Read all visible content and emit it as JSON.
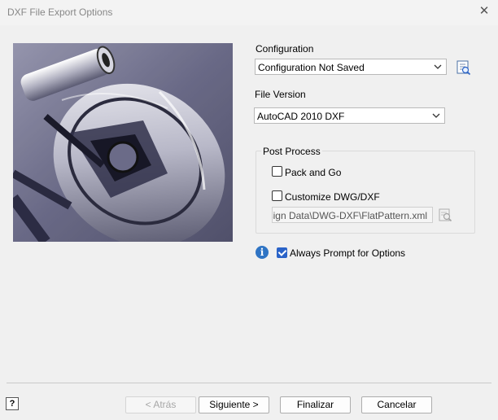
{
  "window": {
    "title": "DXF File Export Options",
    "close_icon": "close-icon"
  },
  "preview": {
    "icon": "part-preview-image"
  },
  "configuration": {
    "label": "Configuration",
    "value": "Configuration Not Saved",
    "browse_icon": "configuration-browse-icon"
  },
  "file_version": {
    "label": "File Version",
    "value": "AutoCAD 2010 DXF"
  },
  "post_process": {
    "title": "Post Process",
    "pack_and_go": {
      "label": "Pack and Go",
      "checked": false
    },
    "customize": {
      "label": "Customize DWG/DXF",
      "checked": false
    },
    "path": "Design Data\\DWG-DXF\\FlatPattern.xml",
    "path_browse_icon": "folder-browse-icon"
  },
  "always_prompt": {
    "label": "Always Prompt for Options",
    "checked": true,
    "info_glyph": "i"
  },
  "footer": {
    "help_glyph": "?",
    "back": "< Atrás",
    "next": "Siguiente >",
    "finish": "Finalizar",
    "cancel": "Cancelar"
  },
  "colors": {
    "accent": "#2a63c8",
    "info": "#2f74c4"
  }
}
